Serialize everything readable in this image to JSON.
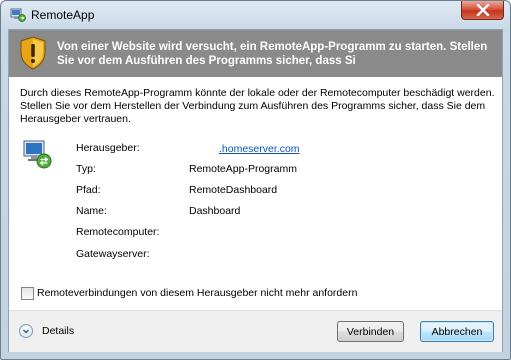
{
  "window": {
    "title": "RemoteApp",
    "close_label": "close"
  },
  "banner": {
    "text": "Von einer Website wird versucht, ein RemoteApp-Programm zu starten. Stellen Sie vor dem Ausführen des Programms sicher, dass Si"
  },
  "description": "Durch dieses RemoteApp-Programm könnte der lokale oder der Remotecomputer beschädigt werden. Stellen Sie vor dem Herstellen der Verbindung zum Ausführen des Programms sicher, dass Sie dem Herausgeber vertrauen.",
  "details": {
    "publisher_label": "Herausgeber:",
    "publisher_value": ".homeserver.com",
    "type_label": "Typ:",
    "type_value": "RemoteApp-Programm",
    "path_label": "Pfad:",
    "path_value": "RemoteDashboard",
    "name_label": "Name:",
    "name_value": "Dashboard",
    "remote_computer_label": "Remotecomputer:",
    "gateway_label": "Gatewayserver:"
  },
  "checkbox": {
    "label": "Remoteverbindungen von diesem Herausgeber nicht mehr anfordern",
    "checked": false
  },
  "footer": {
    "details_label": "Details",
    "connect_label": "Verbinden",
    "cancel_label": "Abbrechen"
  },
  "icons": {
    "app": "remoteapp-icon",
    "warning": "shield-warning-icon",
    "remote": "remote-computer-icon",
    "expand": "chevron-down-icon"
  },
  "colors": {
    "banner": "#8a8a8a",
    "link": "#0a53b9",
    "close_button": "#c2351c"
  }
}
